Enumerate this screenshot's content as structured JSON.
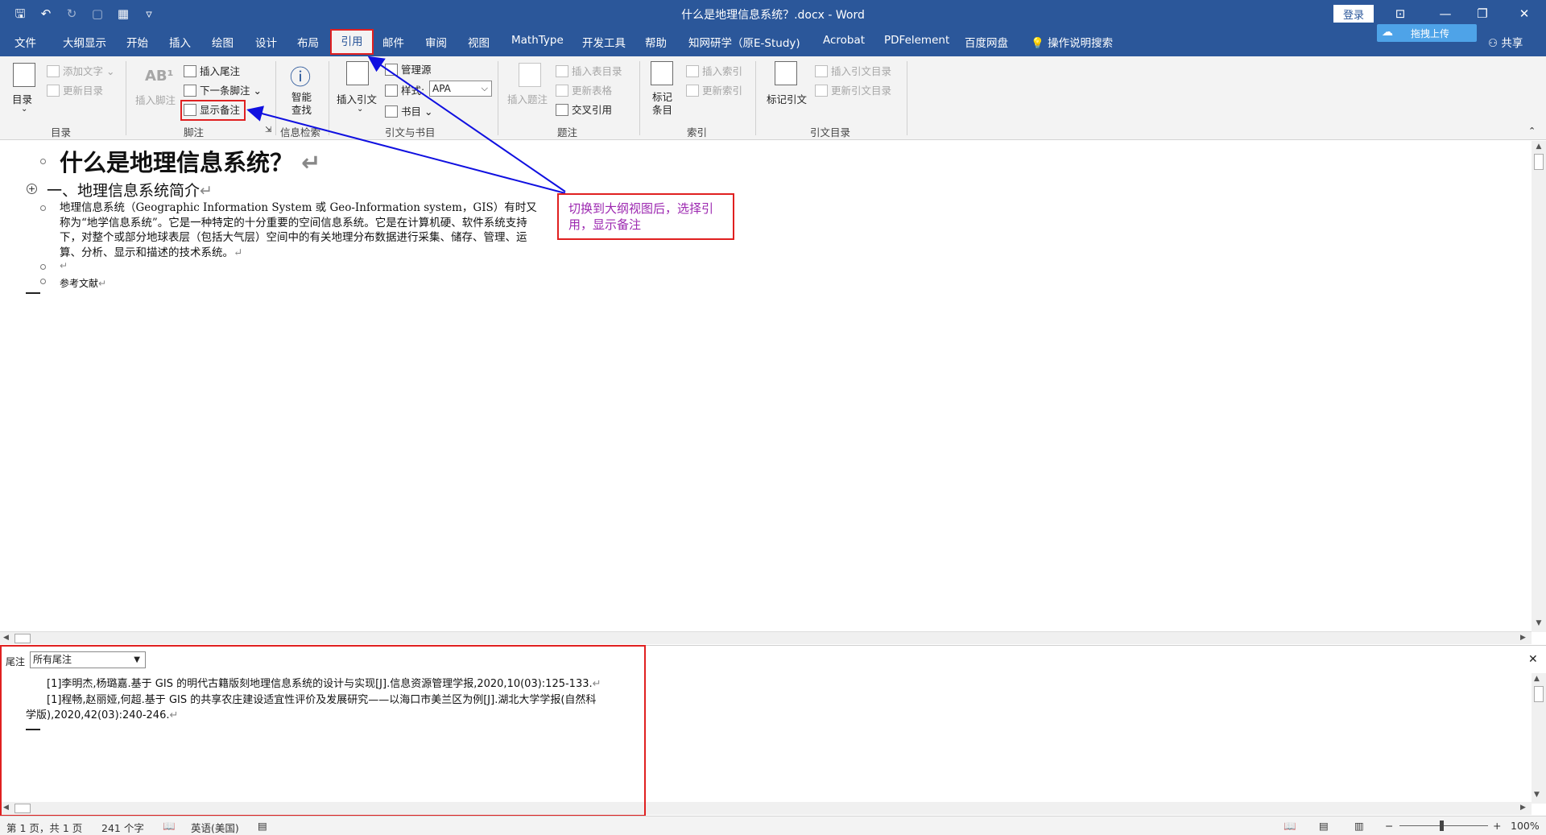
{
  "titlebar": {
    "title": "什么是地理信息系统？.docx  -  Word",
    "login": "登录",
    "ribbon_display_icon": "ribbon-display-icon",
    "minimize": "—",
    "restore": "❐",
    "close": "✕"
  },
  "menu": {
    "items": [
      "文件",
      "大纲显示",
      "开始",
      "插入",
      "绘图",
      "设计",
      "布局",
      "引用",
      "邮件",
      "审阅",
      "视图",
      "MathType",
      "开发工具",
      "帮助",
      "知网研学（原E-Study)",
      "Acrobat",
      "PDFelement",
      "百度网盘"
    ],
    "active": "引用",
    "tell_me": "操作说明搜索",
    "share": "共享",
    "upload": "拖拽上传"
  },
  "ribbon": {
    "toc": {
      "toc": "目录",
      "add_text": "添加文字",
      "update_toc": "更新目录",
      "group": "目录"
    },
    "footnotes": {
      "insert_footnote": "插入脚注",
      "insert_endnote": "插入尾注",
      "next_footnote": "下一条脚注",
      "show_notes": "显示备注",
      "group": "脚注"
    },
    "research": {
      "smart_lookup_1": "智能",
      "smart_lookup_2": "查找",
      "group": "信息检索"
    },
    "citations": {
      "insert_citation": "插入引文",
      "manage_sources": "管理源",
      "style_label": "样式:",
      "style_value": "APA",
      "bibliography": "书目",
      "group": "引文与书目"
    },
    "captions": {
      "insert_caption": "插入题注",
      "insert_table_figures": "插入表目录",
      "update_table": "更新表格",
      "cross_reference": "交叉引用",
      "group": "题注"
    },
    "index": {
      "mark_entry_1": "标记",
      "mark_entry_2": "条目",
      "insert_index": "插入索引",
      "update_index": "更新索引",
      "group": "索引"
    },
    "toa": {
      "mark_citation": "标记引文",
      "insert_toa": "插入引文目录",
      "update_toa": "更新引文目录",
      "group": "引文目录"
    }
  },
  "document": {
    "title": "什么是地理信息系统？",
    "heading": "一、地理信息系统简介",
    "paragraph": "地理信息系统（Geographic Information System 或 Geo-Information system，GIS）有时又称为“地学信息系统”。它是一种特定的十分重要的空间信息系统。它是在计算机硬、软件系统支持下，对整个或部分地球表层（包括大气层）空间中的有关地理分布数据进行采集、储存、管理、运算、分析、显示和描述的技术系统。",
    "references_title": "参考文献",
    "para_mark": "↵"
  },
  "callout": {
    "text": "切换到大纲视图后，选择引用，显示备注"
  },
  "notes_pane": {
    "label": "尾注",
    "filter": "所有尾注",
    "endnote1": "[1]李明杰,杨璐嘉.基于 GIS 的明代古籍版刻地理信息系统的设计与实现[J].信息资源管理学报,2020,10(03):125-133.",
    "endnote2": "[1]程畅,赵丽娅,何超.基于 GIS 的共享农庄建设适宜性评价及发展研究——以海口市美兰区为例[J].湖北大学学报(自然科学版),2020,42(03):240-246."
  },
  "status": {
    "page": "第 1 页，共 1 页",
    "words": "241 个字",
    "language": "英语(美国)",
    "zoom": "100%"
  }
}
